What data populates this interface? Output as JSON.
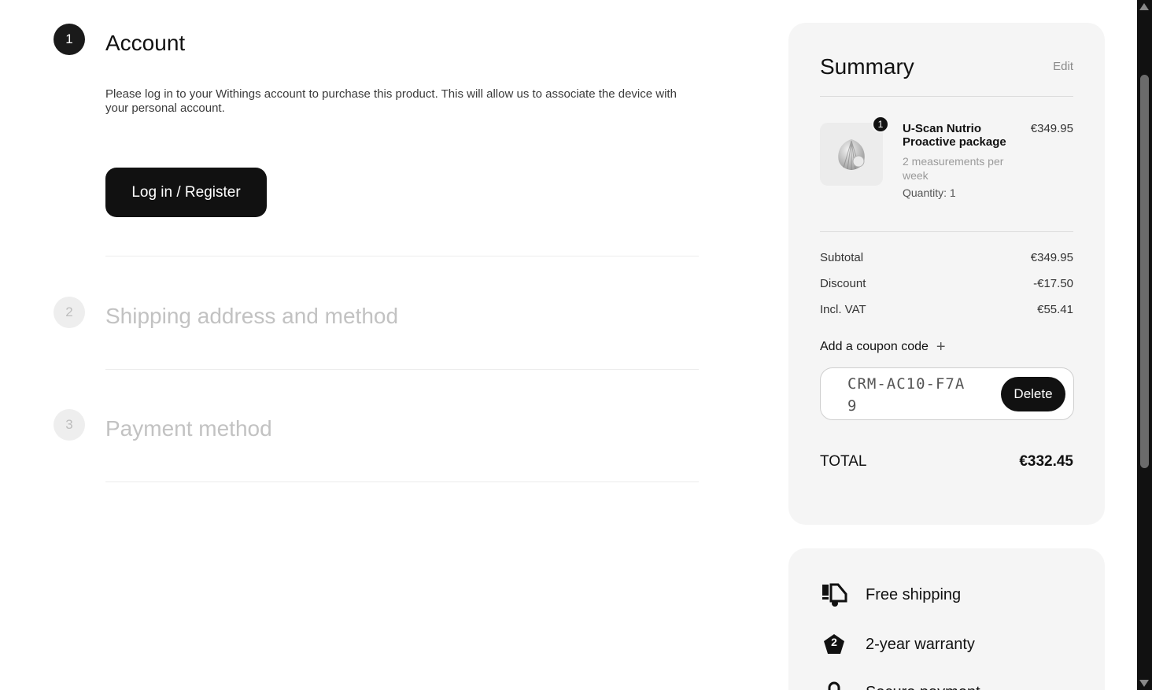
{
  "steps": [
    {
      "number": "1",
      "title": "Account",
      "state": "active"
    },
    {
      "number": "2",
      "title": "Shipping address and method",
      "state": "inactive"
    },
    {
      "number": "3",
      "title": "Payment method",
      "state": "inactive"
    }
  ],
  "account": {
    "description": "Please log in to your Withings account to purchase this product. This will allow us to associate the device with your personal account.",
    "login_button": "Log in / Register"
  },
  "summary": {
    "title": "Summary",
    "edit_label": "Edit",
    "product": {
      "quantity_badge": "1",
      "name": "U-Scan Nutrio Proactive package",
      "variant": "2 measurements per week",
      "quantity_text": "Quantity: 1",
      "price": "€349.95",
      "image_icon": "shell-product-icon"
    },
    "rows": [
      {
        "label": "Subtotal",
        "value": "€349.95"
      },
      {
        "label": "Discount",
        "value": "-€17.50"
      },
      {
        "label": "Incl. VAT",
        "value": "€55.41"
      }
    ],
    "coupon": {
      "toggle_label": "Add a coupon code",
      "toggle_icon": "+",
      "code": "CRM-AC10-F7A9",
      "delete_button": "Delete"
    },
    "total": {
      "label": "TOTAL",
      "value": "€332.45"
    }
  },
  "perks": [
    {
      "icon": "truck-icon",
      "label": "Free shipping"
    },
    {
      "icon": "warranty-badge-icon",
      "badge_text": "2",
      "label": "2-year warranty"
    },
    {
      "icon": "lock-icon",
      "label": "Secure payment"
    }
  ],
  "colors": {
    "primary": "#111111",
    "card_bg": "#f5f5f5",
    "inactive_text": "#c2c2c2"
  }
}
